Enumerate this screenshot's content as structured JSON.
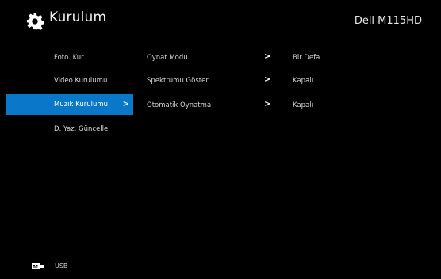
{
  "header": {
    "icon": "gear-icon",
    "title": "Kurulum",
    "model": "Dell M115HD"
  },
  "menu": {
    "items": [
      {
        "label": "Foto. Kur."
      },
      {
        "label": "Video Kurulumu"
      },
      {
        "label": "Müzik Kurulumu",
        "active": true
      },
      {
        "label": "D. Yaz. Güncelle"
      }
    ],
    "active_arrow": ">"
  },
  "settings": {
    "rows": [
      {
        "name": "Oynat Modu",
        "arrow": ">",
        "value": "Bir Defa"
      },
      {
        "name": "Spektrumu Göster",
        "arrow": ">",
        "value": "Kapalı"
      },
      {
        "name": "Otomatik Oynatma",
        "arrow": ">",
        "value": "Kapalı"
      }
    ]
  },
  "footer": {
    "source_icon": "usb-icon",
    "source_label": "USB"
  },
  "colors": {
    "background": "#000000",
    "highlight": "#0a77c8",
    "text": "#d6d6d6"
  }
}
